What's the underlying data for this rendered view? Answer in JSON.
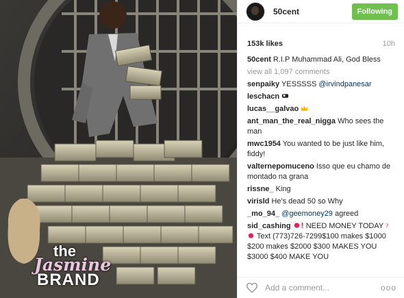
{
  "photo": {
    "alt_subject": "man in suit on vault steps with stacks of cash"
  },
  "watermark": {
    "line1": "the",
    "line2": "Jasmine",
    "line3": "BRAND"
  },
  "post": {
    "username": "50cent",
    "follow_label": "Following",
    "likes": "153k likes",
    "time": "10h",
    "caption_user": "50cent",
    "caption_text": "R.I.P Muhammad Ali, God Bless",
    "view_all": "view all 1,097 comments",
    "comments": [
      {
        "user": "senpaiky",
        "text": "YESSSSS",
        "mention": "@irvindpanesar"
      },
      {
        "user": "leschacn",
        "text": "",
        "emoji": "cow-icon"
      },
      {
        "user": "lucas__galvao",
        "text": "",
        "emoji": "crown-icon"
      },
      {
        "user": "ant_man_the_real_nigga",
        "text": "Who sees the man"
      },
      {
        "user": "mwc1954",
        "text": "You wanted to be just like him, fiddy!"
      },
      {
        "user": "valternepomuceno",
        "text": "Isso que eu chamo de montado na grana"
      },
      {
        "user": "rissne_",
        "text": "King"
      },
      {
        "user": "virisld",
        "text": "He's dead 50 so Why"
      },
      {
        "user": "_mo_94_",
        "text": "agreed",
        "mention": "@geemoney29"
      },
      {
        "user": "sid_cashing",
        "text_a": "NEED MONEY TODAY",
        "text_b": "Text (773)726-7299$100 makes $1000 $200 makes $2000 $300 MAKES YOU $3000 $400 MAKE YOU"
      }
    ],
    "add_comment_placeholder": "Add a comment...",
    "more_label": "ooo"
  },
  "colors": {
    "follow_bg": "#70c050",
    "mention": "#003569",
    "muted": "#999999"
  }
}
